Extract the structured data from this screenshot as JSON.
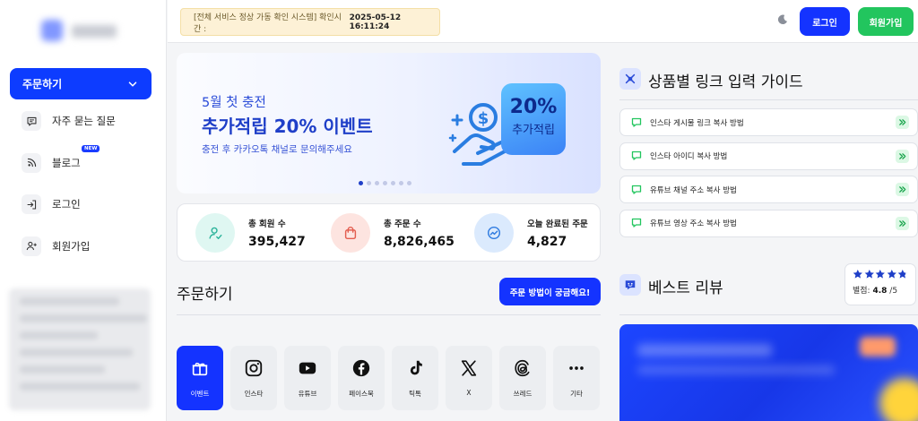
{
  "sidebar": {
    "order_button": "주문하기",
    "items": [
      {
        "label": "자주 묻는 질문",
        "icon": "faq-icon"
      },
      {
        "label": "블로그",
        "icon": "blog-icon",
        "badge": "NEW"
      },
      {
        "label": "로그인",
        "icon": "login-icon"
      },
      {
        "label": "회원가입",
        "icon": "user-plus-icon"
      }
    ]
  },
  "topbar": {
    "notice_prefix": "[전체 서비스 정상 가동 확인 시스템] 확인시간 :",
    "notice_time": "2025-05-12 16:11:24",
    "login": "로그인",
    "signup": "회원가입"
  },
  "banner": {
    "line1": "5월 첫 충전",
    "line2": "추가적립 20% 이벤트",
    "line3": "충전 후 카카오톡 채널로 문의해주세요",
    "badge_pct": "20%",
    "badge_text": "추가적립",
    "slides": 7,
    "active_slide": 1
  },
  "stats": [
    {
      "label": "총 회원 수",
      "value": "395,427",
      "color": "#dff7f2",
      "stroke": "#2bb39a"
    },
    {
      "label": "총 주문 수",
      "value": "8,826,465",
      "color": "#fde4e0",
      "stroke": "#e35d4f"
    },
    {
      "label": "오늘 완료된 주문",
      "value": "4,827",
      "color": "#dbeafd",
      "stroke": "#2f7be0"
    }
  ],
  "order": {
    "title": "주문하기",
    "howto": "주문 방법이 궁금해요!",
    "categories": [
      {
        "label": "이벤트",
        "icon": "gift-icon",
        "active": true
      },
      {
        "label": "인스타",
        "icon": "instagram-icon"
      },
      {
        "label": "유튜브",
        "icon": "youtube-icon"
      },
      {
        "label": "페이스북",
        "icon": "facebook-icon"
      },
      {
        "label": "틱톡",
        "icon": "tiktok-icon"
      },
      {
        "label": "X",
        "icon": "x-icon"
      },
      {
        "label": "쓰레드",
        "icon": "threads-icon"
      },
      {
        "label": "기타",
        "icon": "more-icon"
      }
    ]
  },
  "guide": {
    "title": "상품별 링크 입력 가이드",
    "items": [
      "인스타 게시물 링크 복사 방법",
      "인스타 아이디 복사 방법",
      "유튜브 채널 주소 복사 방법",
      "유튜브 영상 주소 복사 방법"
    ]
  },
  "reviews": {
    "title": "베스트 리뷰",
    "rating_label": "별점:",
    "rating_value": "4.8",
    "rating_max": "/5",
    "stars": 4.8
  },
  "colors": {
    "primary": "#1433ff",
    "green": "#22c55e"
  }
}
